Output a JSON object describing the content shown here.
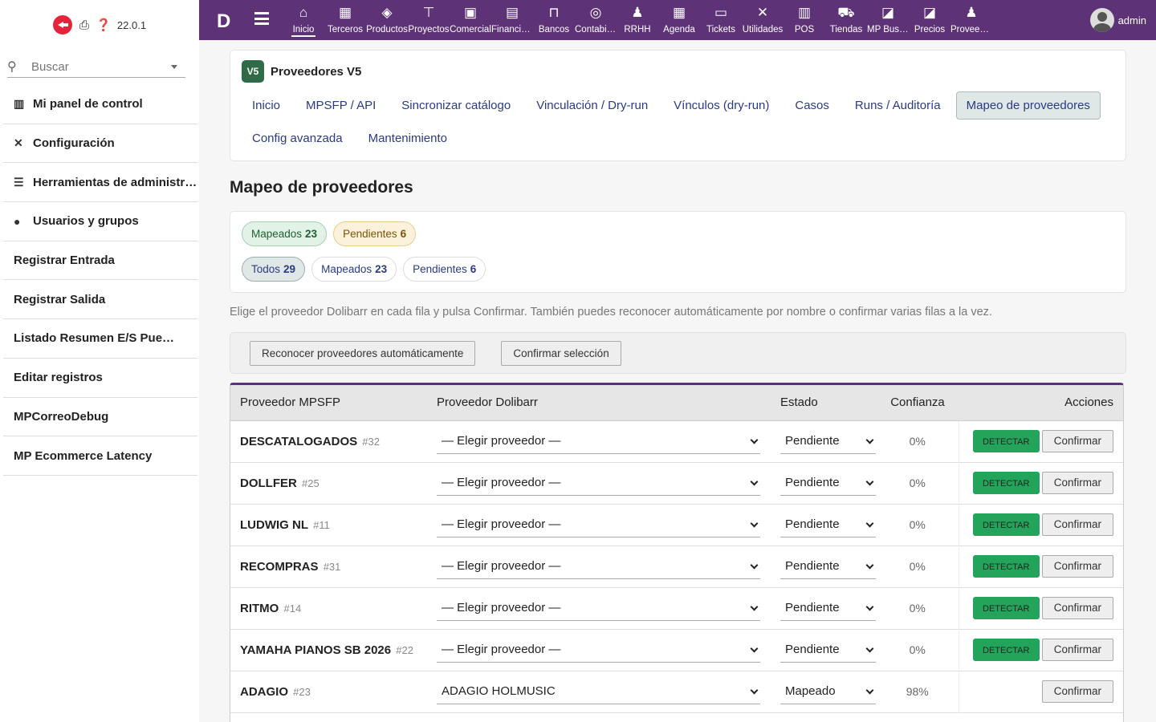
{
  "left_panel": {
    "version": "22.0.1",
    "search_placeholder": "Buscar",
    "menu": [
      {
        "icon": "chart-bar-icon",
        "glyph": "▥",
        "label": "Mi panel de control"
      },
      {
        "icon": "tools-icon",
        "glyph": "✕",
        "label": "Configuración"
      },
      {
        "icon": "server-icon",
        "glyph": "☰",
        "label": "Herramientas de administración"
      },
      {
        "icon": "user-icon",
        "glyph": "●",
        "label": "Usuarios y grupos"
      },
      {
        "icon": "",
        "glyph": "",
        "label": "Registrar Entrada"
      },
      {
        "icon": "",
        "glyph": "",
        "label": "Registrar Salida"
      },
      {
        "icon": "",
        "glyph": "",
        "label": "Listado Resumen E/S Puesto de Trabajo"
      },
      {
        "icon": "",
        "glyph": "",
        "label": "Editar registros"
      },
      {
        "icon": "",
        "glyph": "",
        "label": "MPCorreoDebug"
      },
      {
        "icon": "",
        "glyph": "",
        "label": "MP Ecommerce Latency"
      }
    ]
  },
  "topbar": {
    "logo": "D",
    "items": [
      {
        "label": "Inicio",
        "icon": "home-icon",
        "glyph": "⌂"
      },
      {
        "label": "Terceros",
        "icon": "building-icon",
        "glyph": "▦"
      },
      {
        "label": "Productos",
        "icon": "cube-icon",
        "glyph": "◈"
      },
      {
        "label": "Proyectos",
        "icon": "sitemap-icon",
        "glyph": "⊤"
      },
      {
        "label": "Comercial",
        "icon": "suitcase-icon",
        "glyph": "▣"
      },
      {
        "label": "Financiera",
        "icon": "invoice-icon",
        "glyph": "▤"
      },
      {
        "label": "Bancos",
        "icon": "bank-icon",
        "glyph": "⊓"
      },
      {
        "label": "Contabilidad",
        "icon": "search-dollar-icon",
        "glyph": "◎"
      },
      {
        "label": "RRHH",
        "icon": "user-tie-icon",
        "glyph": "♟"
      },
      {
        "label": "Agenda",
        "icon": "calendar-icon",
        "glyph": "▦"
      },
      {
        "label": "Tickets",
        "icon": "ticket-icon",
        "glyph": "▭"
      },
      {
        "label": "Utilidades",
        "icon": "tools-icon",
        "glyph": "✕"
      },
      {
        "label": "POS",
        "icon": "cash-register-icon",
        "glyph": "▥"
      },
      {
        "label": "Tiendas",
        "icon": "cart-icon",
        "glyph": "⛟"
      },
      {
        "label": "MP Buscador",
        "icon": "note-icon",
        "glyph": "◪"
      },
      {
        "label": "Precios",
        "icon": "note-icon",
        "glyph": "◪"
      },
      {
        "label": "Proveedores",
        "icon": "user-lock-icon",
        "glyph": "♟"
      }
    ],
    "user": "admin"
  },
  "header_card": {
    "badge": "V5",
    "title": "Proveedores V5",
    "tabs": [
      "Inicio",
      "MPSFP / API",
      "Sincronizar catálogo",
      "Vinculación / Dry-run",
      "Vínculos (dry-run)",
      "Casos",
      "Runs / Auditoría",
      "Mapeo de proveedores",
      "Config avanzada",
      "Mantenimiento"
    ],
    "active_tab": "Mapeo de proveedores"
  },
  "page_title": "Mapeo de proveedores",
  "summary": [
    {
      "label": "Mapeados",
      "count": "23"
    },
    {
      "label": "Pendientes",
      "count": "6"
    }
  ],
  "filters": [
    {
      "label": "Todos",
      "count": "29"
    },
    {
      "label": "Mapeados",
      "count": "23"
    },
    {
      "label": "Pendientes",
      "count": "6"
    }
  ],
  "hint": "Elige el proveedor Dolibarr en cada fila y pulsa Confirmar. También puedes reconocer automáticamente por nombre o confirmar varias filas a la vez.",
  "actions": {
    "auto": "Reconocer proveedores automáticamente",
    "confirm_selection": "Confirmar selección"
  },
  "table": {
    "headers": [
      "Proveedor MPSFP",
      "Proveedor Dolibarr",
      "Estado",
      "Confianza",
      "Acciones"
    ],
    "detect_label": "DETECTAR",
    "confirm_label": "Confirmar",
    "rows": [
      {
        "name": "DESCATALOGADOS",
        "id": "#32",
        "dolibarr": "— Elegir proveedor —",
        "estado": "Pendiente",
        "confianza": "0%",
        "detect": true
      },
      {
        "name": "DOLLFER",
        "id": "#25",
        "dolibarr": "— Elegir proveedor —",
        "estado": "Pendiente",
        "confianza": "0%",
        "detect": true
      },
      {
        "name": "LUDWIG NL",
        "id": "#11",
        "dolibarr": "— Elegir proveedor —",
        "estado": "Pendiente",
        "confianza": "0%",
        "detect": true
      },
      {
        "name": "RECOMPRAS",
        "id": "#31",
        "dolibarr": "— Elegir proveedor —",
        "estado": "Pendiente",
        "confianza": "0%",
        "detect": true
      },
      {
        "name": "RITMO",
        "id": "#14",
        "dolibarr": "— Elegir proveedor —",
        "estado": "Pendiente",
        "confianza": "0%",
        "detect": true
      },
      {
        "name": "YAMAHA PIANOS SB 2026",
        "id": "#22",
        "dolibarr": "— Elegir proveedor —",
        "estado": "Pendiente",
        "confianza": "0%",
        "detect": true
      },
      {
        "name": "ADAGIO",
        "id": "#23",
        "dolibarr": "ADAGIO HOLMUSIC",
        "estado": "Mapeado",
        "confianza": "98%",
        "detect": false
      }
    ]
  },
  "colors": {
    "topbar": "#5e3276",
    "detect": "#22a55a",
    "badge": "#2e6b46",
    "link": "#2a3a84"
  }
}
